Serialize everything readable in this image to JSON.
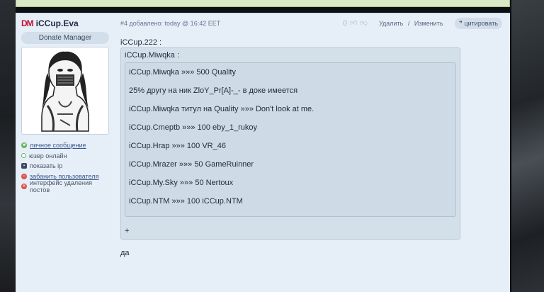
{
  "user": {
    "logo": "DM",
    "name": "iCCup.Eva",
    "role": "Donate Manager",
    "actions": [
      {
        "label": "личное сообщение",
        "icon": "chat-icon",
        "color": "#5cb85c",
        "link": true
      },
      {
        "label": "юзер онлайн",
        "icon": "online-icon",
        "color": "#5cb85c",
        "link": false
      },
      {
        "label": "показать ip",
        "icon": "computer-icon",
        "color": "#3a4a60",
        "link": false
      },
      {
        "label": "забанить пользователя",
        "icon": "ban-icon",
        "color": "#d9534f",
        "link": true
      },
      {
        "label": "интерфейс удаления постов",
        "icon": "delete-icon",
        "color": "#d9534f",
        "link": false
      }
    ]
  },
  "post": {
    "meta": "#4 добавлено: today @ 16:42 EET",
    "score": "0",
    "delete_label": "Удалить",
    "sep": "/",
    "edit_label": "Изменить",
    "quote_label": "цитировать",
    "quoted_author": "iCCup.222 :",
    "quote_label_inner": "iCCup.Miwqka :",
    "quote_lines": [
      "iCCup.Miwqka »»» 500 Quality",
      "25% другу на ник ZloY_Pr[A]-_- в доке имеется",
      "iCCup.Miwqka титул на Quality »»» Don't look at me.",
      "iCCup.Cmeptb »»» 100 eby_1_rukoy",
      "iCCup.Hrap »»» 100 VR_46",
      "iCCup.Mrazer »»» 50 GameRuinner",
      "iCCup.My.Sky »»» 50 Nertoux",
      "iCCup.NTM »»» 100 iCCup.NTM"
    ],
    "plus": "+",
    "reply": "да"
  },
  "colors": {
    "post_bg": "#e6eef7",
    "quote_bg": "#d3dfe9",
    "banner": "#dbe8c7"
  }
}
